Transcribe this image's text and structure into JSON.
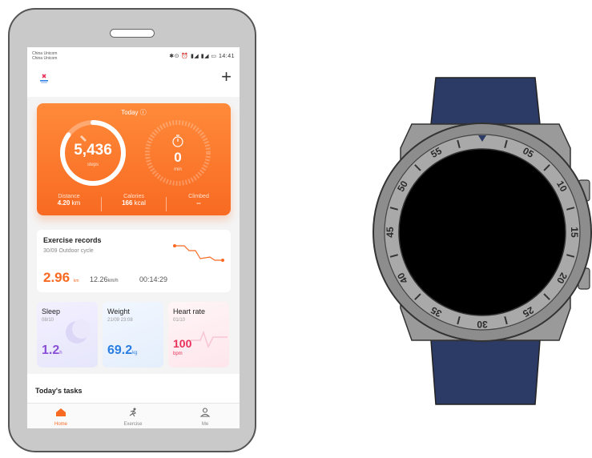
{
  "status_bar": {
    "carrier_1": "China Unicom",
    "carrier_2": "China Unicom",
    "icons": "✱⊙ ⏰ ▮◢ ▮◢ ▭",
    "time": "14:41"
  },
  "app_bar": {
    "logo_icon": "health-logo-icon",
    "add_icon": "plus-icon",
    "add_label": "+"
  },
  "today_card": {
    "title": "Today ⓘ",
    "steps_value": "5,436",
    "steps_unit": "steps",
    "steps_progress": 0.85,
    "active_value": "0",
    "active_unit": "min",
    "stats": [
      {
        "label": "Distance",
        "value": "4.20",
        "unit": "km"
      },
      {
        "label": "Calories",
        "value": "166",
        "unit": "kcal"
      },
      {
        "label": "Climbed",
        "value": "--",
        "unit": ""
      }
    ],
    "accent": "#f86a22"
  },
  "exercise_card": {
    "title": "Exercise records",
    "subtitle": "30/09  Outdoor cycle",
    "distance": "2.96",
    "distance_unit": "km",
    "speed": "12.26",
    "speed_unit": "km/h",
    "duration": "00:14:29"
  },
  "mini_cards": [
    {
      "title": "Sleep",
      "date": "08/10",
      "value": "1.2",
      "unit": "h",
      "color": "#8a4fd6"
    },
    {
      "title": "Weight",
      "date": "21/09 23:08",
      "value": "69.2",
      "unit": "kg",
      "color": "#2a7de1"
    },
    {
      "title": "Heart rate",
      "date": "01/10",
      "value": "100",
      "unit": "bpm",
      "color": "#e8315b"
    }
  ],
  "tasks": {
    "title": "Today's tasks"
  },
  "nav": [
    {
      "label": "Home",
      "icon": "home-icon"
    },
    {
      "label": "Exercise",
      "icon": "runner-icon"
    },
    {
      "label": "Me",
      "icon": "person-icon"
    }
  ],
  "watch": {
    "bezel_labels": [
      "05",
      "10",
      "15",
      "20",
      "25",
      "30",
      "35",
      "40",
      "45",
      "50",
      "55"
    ],
    "strap_color": "#2c3a66"
  }
}
